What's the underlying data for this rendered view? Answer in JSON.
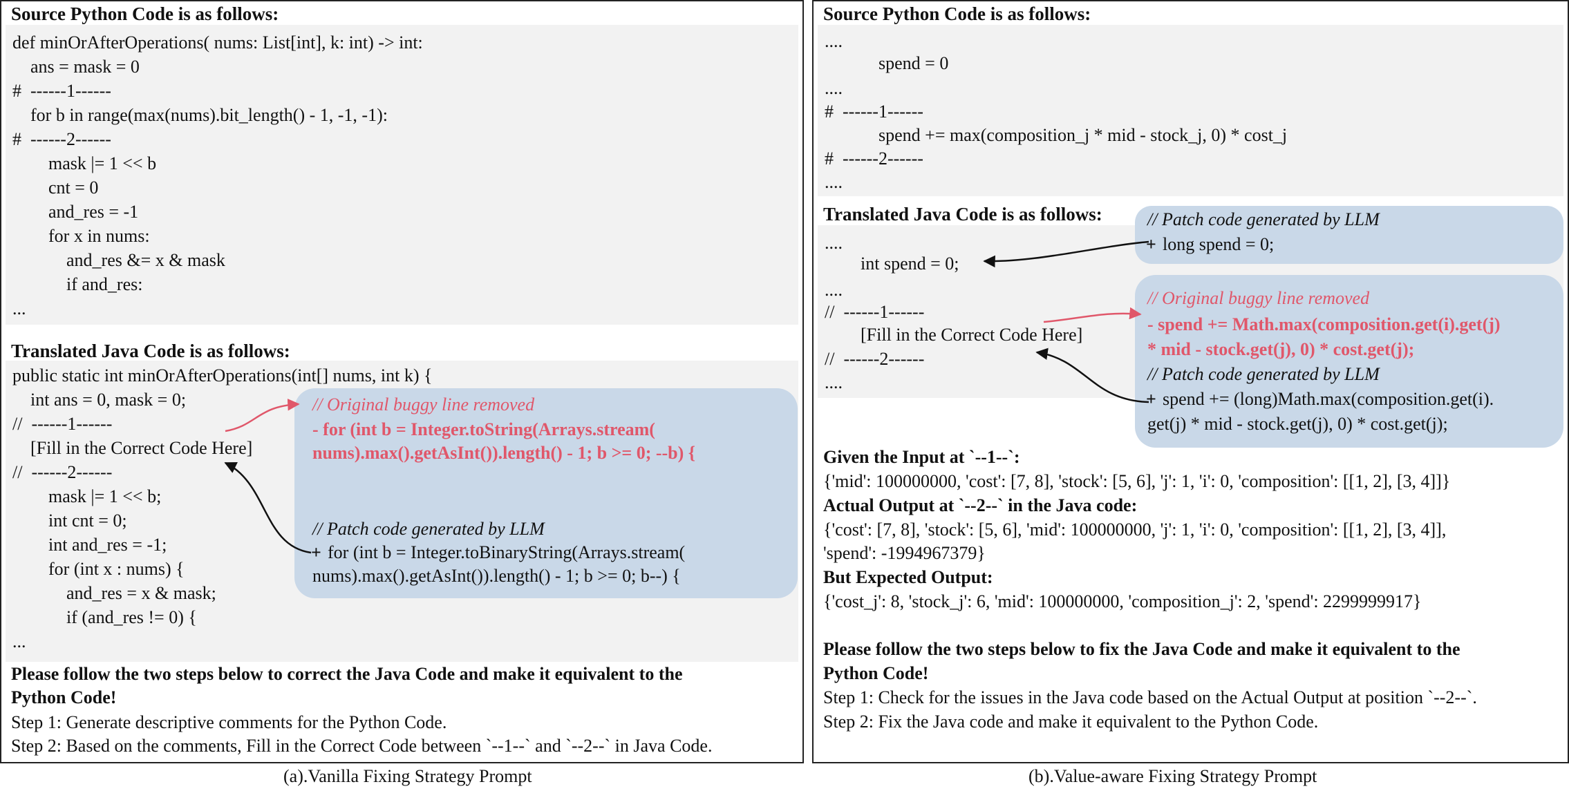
{
  "panel_a": {
    "source_header": "Source Python Code is as follows:",
    "python_lines": [
      "def minOrAfterOperations( nums: List[int], k: int) -> int:",
      "    ans = mask = 0",
      "#  ------1------",
      "    for b in range(max(nums).bit_length() - 1, -1, -1):",
      "#  ------2------",
      "        mask |= 1 << b",
      "        cnt = 0",
      "        and_res = -1",
      "        for x in nums:",
      "            and_res &= x & mask",
      "            if and_res:",
      "..."
    ],
    "java_header": "Translated Java Code is as follows:",
    "java_lines": [
      "public static int minOrAfterOperations(int[] nums, int k) {",
      "    int ans = 0, mask = 0;",
      "//  ------1------",
      "    [Fill in the Correct Code Here]",
      "//  ------2------",
      "        mask |= 1 << b;",
      "        int cnt = 0;",
      "        int and_res = -1;",
      "        for (int x : nums) {",
      "            and_res = x & mask;",
      "            if (and_res != 0) {",
      "..."
    ],
    "bubble": {
      "removed_comment": "// Original buggy line removed",
      "removed_line_1": "- for (int b = Integer.toString(Arrays.stream(",
      "removed_line_2": "nums).max().getAsInt()).length() - 1; b >= 0; --b) {",
      "patch_comment": "// Patch code generated by LLM",
      "patch_line_1": "for (int b = Integer.toBinaryString(Arrays.stream(",
      "patch_line_2": "nums).max().getAsInt()).length() - 1; b >= 0; b--) {"
    },
    "instructions": [
      "Please follow the two steps below to correct the Java Code and make it equivalent to the",
      "Python Code!",
      "Step 1: Generate descriptive comments for the Python Code.",
      "Step 2: Based on the comments, Fill in the Correct Code between `--1--` and `--2--` in Java Code."
    ],
    "caption": "(a).Vanilla Fixing Strategy Prompt"
  },
  "panel_b": {
    "source_header": "Source Python Code is as follows:",
    "python_lines": [
      "....",
      "            spend = 0",
      "....",
      "#  ------1------",
      "            spend += max(composition_j * mid - stock_j, 0) * cost_j",
      "#  ------2------",
      "...."
    ],
    "java_header": "Translated Java Code is as follows:",
    "java_lines": [
      "....",
      "        int spend = 0;",
      "....",
      "//  ------1------",
      "        [Fill in the Correct Code Here]",
      "//  ------2------",
      "...."
    ],
    "bubble_top": {
      "patch_comment": "// Patch code generated by LLM",
      "patch_line": "long spend = 0;"
    },
    "bubble_main": {
      "removed_comment": "// Original buggy line removed",
      "removed_line_1": "- spend += Math.max(composition.get(i).get(j)",
      "removed_line_2": "* mid - stock.get(j), 0) * cost.get(j);",
      "patch_comment": "// Patch code generated by LLM",
      "patch_line_1": "spend += (long)Math.max(composition.get(i).",
      "patch_line_2": "get(j) * mid - stock.get(j), 0) * cost.get(j);"
    },
    "plus_sign": "+",
    "given_input_label": "Given the Input at `--1--`:",
    "given_input_value": "{'mid': 100000000, 'cost': [7, 8], 'stock': [5, 6], 'j': 1, 'i': 0, 'composition': [[1, 2], [3, 4]]}",
    "actual_output_label": "Actual Output at `--2--` in the Java code:",
    "actual_output_value_1": "{'cost': [7, 8], 'stock': [5, 6], 'mid': 100000000, 'j': 1, 'i': 0, 'composition': [[1, 2], [3, 4]],",
    "actual_output_value_2": "'spend': -1994967379}",
    "expected_label": "But Expected Output:",
    "expected_value": "{'cost_j': 8, 'stock_j': 6, 'mid': 100000000, 'composition_j': 2, 'spend': 2299999917}",
    "instructions": [
      "Please follow the two steps below to fix the Java Code and make it equivalent to the",
      "Python Code!",
      "Step 1: Check for the issues in the Java code based on the Actual Output at position `--2--`.",
      "Step 2: Fix the Java code and make it equivalent to the Python Code."
    ],
    "caption": "(b).Value-aware Fixing Strategy Prompt"
  },
  "colors": {
    "bubble": "#c9d8e8",
    "removed": "#e0576a",
    "gray_block": "#f2f2f2"
  }
}
